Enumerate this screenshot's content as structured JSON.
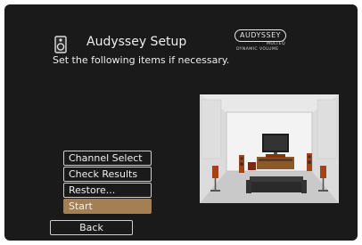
{
  "header": {
    "title": "Audyssey Setup",
    "subtitle": "Set the following items if necessary."
  },
  "logo": {
    "brand": "AUDYSSEY",
    "line1": "MULTEQ",
    "line2": "DYNAMIC VOLUME"
  },
  "menu": {
    "items": [
      {
        "label": "Channel Select"
      },
      {
        "label": "Check Results"
      },
      {
        "label": "Restore..."
      },
      {
        "label": "Start"
      }
    ],
    "selected": "Start"
  },
  "back": {
    "label": "Back"
  },
  "colors": {
    "background": "#1a1a1a",
    "selection": "#a57f54",
    "text": "#eeeeee"
  },
  "illustration": {
    "icon": "speaker-room-diagram"
  }
}
